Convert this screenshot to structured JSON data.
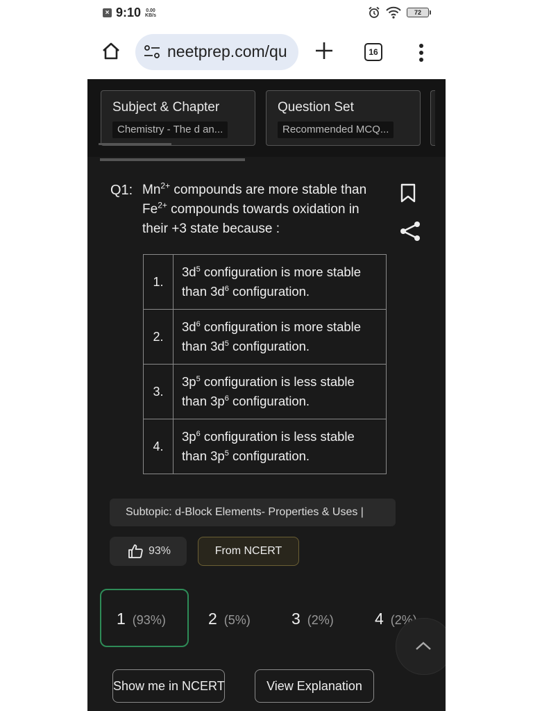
{
  "status_bar": {
    "time": "9:10",
    "speed_value": "0.00",
    "speed_unit": "KB/s",
    "battery": "72"
  },
  "browser": {
    "url": "neetprep.com/qu",
    "tab_count": "16"
  },
  "selectors": [
    {
      "title": "Subject & Chapter",
      "value": "Chemistry - The d an..."
    },
    {
      "title": "Question Set",
      "value": "Recommended MCQ..."
    }
  ],
  "question": {
    "number": "Q1:",
    "line1_a": "Mn",
    "line1_sup": "2+",
    "line1_b": " compounds are more stable than ",
    "line2_a": "Fe",
    "line2_sup": "2+",
    "line2_b": " compounds towards oxidation in",
    "line3": "their +3 state because :"
  },
  "options": [
    {
      "num": "1.",
      "p1": "3d",
      "s1": "5",
      "p2": " configuration is more stable",
      "p3": "than 3d",
      "s2": "6",
      "p4": " configuration."
    },
    {
      "num": "2.",
      "p1": "3d",
      "s1": "6",
      "p2": " configuration is more stable",
      "p3": "than 3d",
      "s2": "5",
      "p4": " configuration."
    },
    {
      "num": "3.",
      "p1": "3p",
      "s1": "5",
      "p2": " configuration is less stable",
      "p3": "than 3p",
      "s2": "6",
      "p4": " configuration."
    },
    {
      "num": "4.",
      "p1": "3p",
      "s1": "6",
      "p2": " configuration is less stable",
      "p3": "than 3p",
      "s2": "5",
      "p4": " configuration."
    }
  ],
  "subtopic": "Subtopic:  d-Block Elements- Properties & Uses |",
  "like_percent": "93%",
  "source_badge": "From NCERT",
  "answer_choices": [
    {
      "num": "1",
      "pct": "(93%)"
    },
    {
      "num": "2",
      "pct": "(5%)"
    },
    {
      "num": "3",
      "pct": "(2%)"
    },
    {
      "num": "4",
      "pct": "(2%)"
    }
  ],
  "buttons": {
    "show_ncert": "Show me in NCERT",
    "view_explanation": "View Explanation"
  },
  "colors": {
    "page_bg": "#1a1a1a",
    "selected_border": "#2e8b57",
    "url_bar_bg": "#e4eaf5"
  }
}
